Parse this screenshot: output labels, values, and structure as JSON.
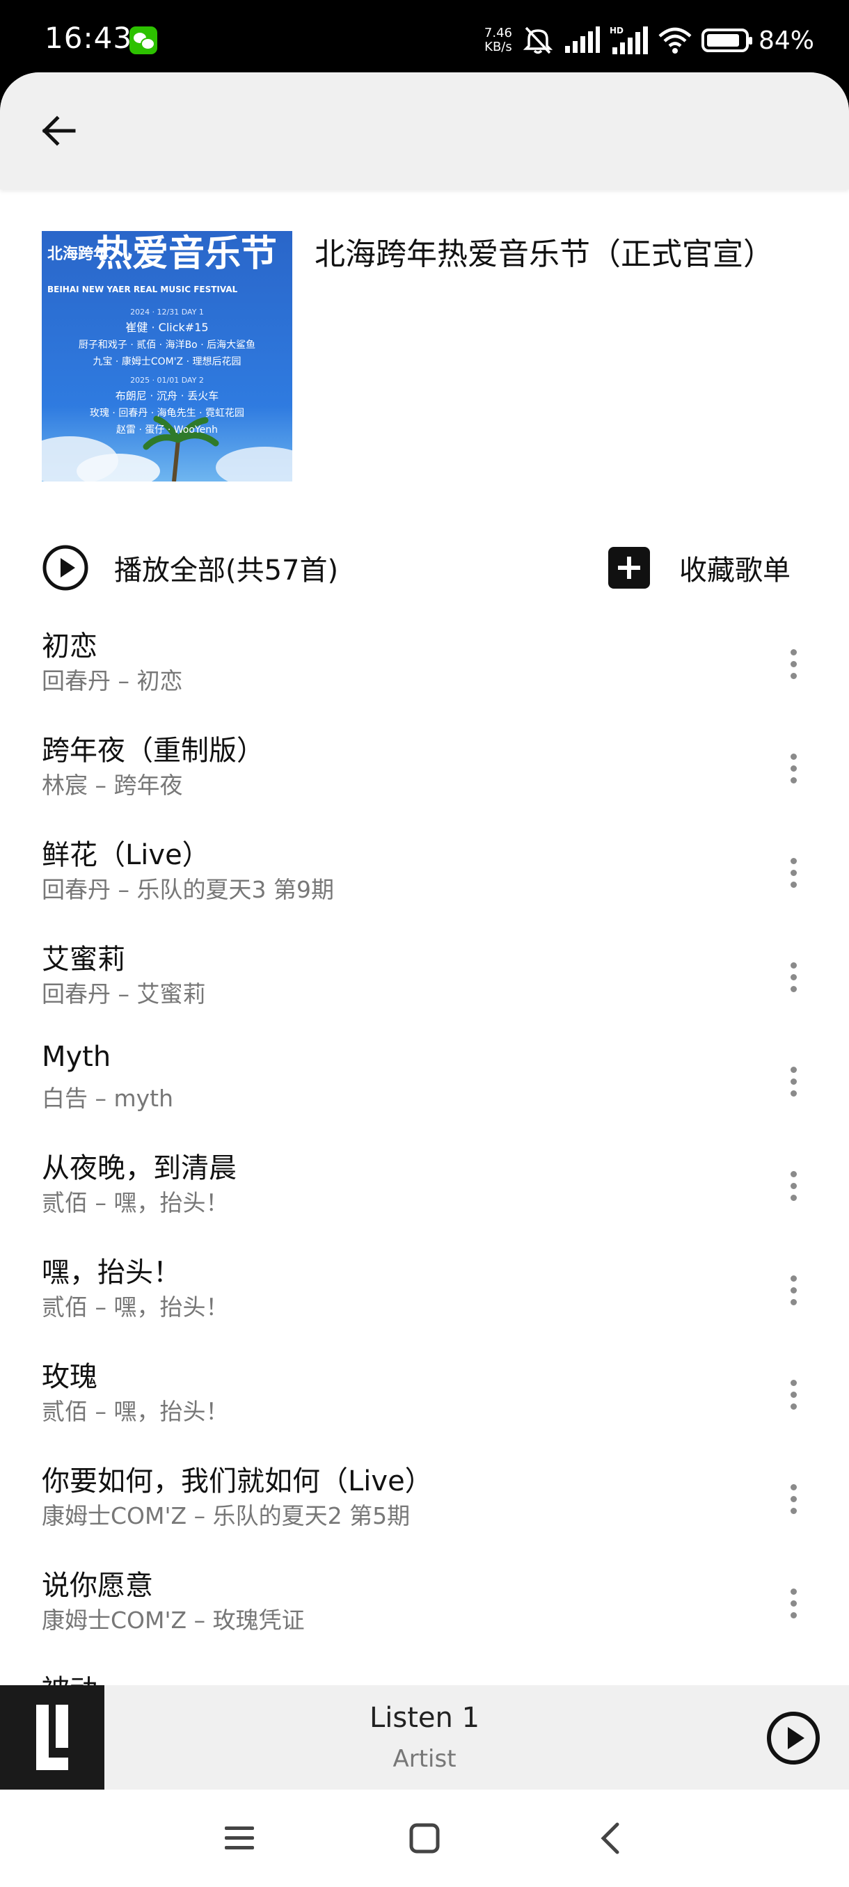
{
  "status_bar": {
    "time": "16:43",
    "net_speed_value": "7.46",
    "net_speed_unit": "KB/s",
    "battery_percent": "84%",
    "icons": [
      "wechat-icon",
      "mute-icon",
      "signal-icon",
      "hd-signal-icon",
      "wifi-icon",
      "battery-icon"
    ]
  },
  "header": {
    "back_icon": "arrow-left-icon"
  },
  "playlist": {
    "title": "北海跨年热爱音乐节（正式官宣）",
    "cover": {
      "tag": "北海跨年",
      "headline": "热爱音乐节",
      "subtitle": "BEIHAI NEW YAER REAL MUSIC FESTIVAL",
      "day1_date": "2024 · 12/31 DAY 1",
      "day1_line1": "崔健 · Click#15",
      "day1_line2": "厨子和戏子 · 贰佰 · 海洋Bo · 后海大鲨鱼",
      "day1_line3": "九宝 · 康姆士COM'Z · 理想后花园",
      "day2_date": "2025 · 01/01 DAY 2",
      "day2_line1": "布朗尼 · 沉舟 · 丢火车",
      "day2_line2": "玫瑰 · 回春丹 · 海龟先生 · 霓虹花园",
      "day2_line3": "赵雷 · 蛋仔 · WooYenh"
    }
  },
  "actions": {
    "play_all_label": "播放全部(共57首)",
    "collect_label": "收藏歌单"
  },
  "songs": [
    {
      "title": "初恋",
      "subtitle": "回春丹 – 初恋"
    },
    {
      "title": "跨年夜（重制版）",
      "subtitle": "林宸 – 跨年夜"
    },
    {
      "title": "鲜花（Live）",
      "subtitle": "回春丹 – 乐队的夏天3 第9期"
    },
    {
      "title": "艾蜜莉",
      "subtitle": "回春丹 – 艾蜜莉"
    },
    {
      "title": "Myth",
      "subtitle": "白告 – myth"
    },
    {
      "title": "从夜晚，到清晨",
      "subtitle": "贰佰 – 嘿，抬头！"
    },
    {
      "title": "嘿，抬头！",
      "subtitle": "贰佰 – 嘿，抬头！"
    },
    {
      "title": "玫瑰",
      "subtitle": "贰佰 – 嘿，抬头！"
    },
    {
      "title": "你要如何，我们就如何（Live）",
      "subtitle": "康姆士COM'Z – 乐队的夏天2 第5期"
    },
    {
      "title": "说你愿意",
      "subtitle": "康姆士COM'Z – 玫瑰凭证"
    },
    {
      "title": "被动",
      "subtitle": ""
    }
  ],
  "player": {
    "title": "Listen 1",
    "artist": "Artist"
  },
  "nav": {
    "icons": [
      "menu-icon",
      "home-icon",
      "back-icon"
    ]
  }
}
